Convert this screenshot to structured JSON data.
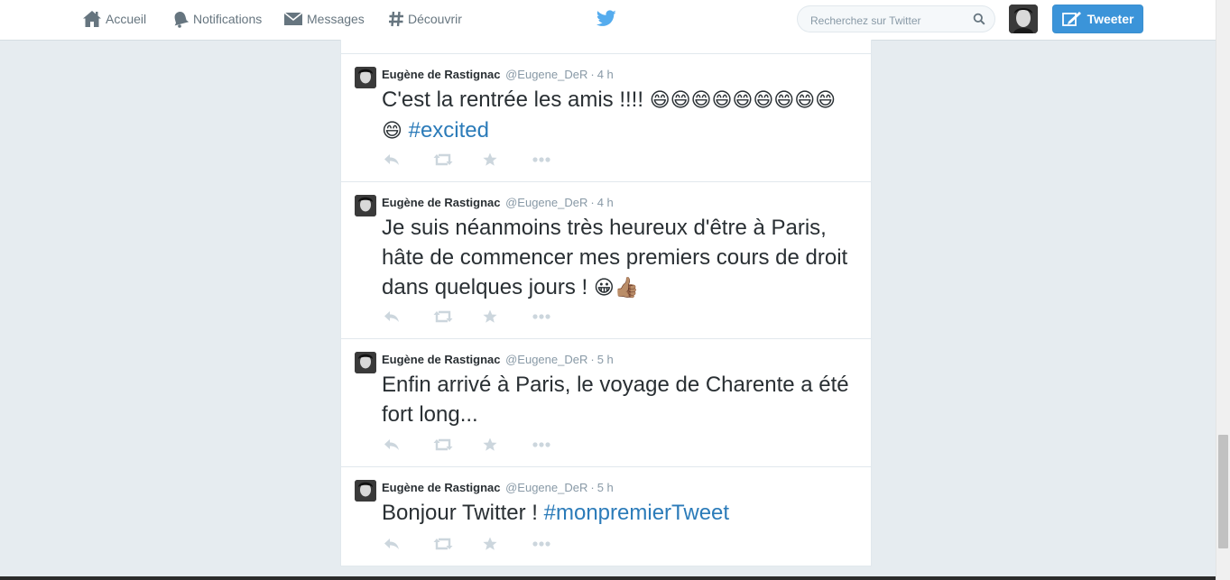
{
  "nav": {
    "home": "Accueil",
    "notifications": "Notifications",
    "messages": "Messages",
    "discover": "Découvrir",
    "logo_icon": "twitter-bird-icon",
    "search_placeholder": "Recherchez sur Twitter",
    "tweet_button": "Tweeter"
  },
  "colors": {
    "accent": "#55acee",
    "link": "#2b7bb9",
    "button": "#3b94d9",
    "background": "#e6ecf0"
  },
  "tweets": [
    {
      "fullname": "Eugène de Rastignac",
      "username": "@Eugene_DeR",
      "time": "4 h",
      "text_before": "C'est la rentrée les amis !!!! ",
      "emoji": "😄😄😄😄😄😄😄😄😄😄",
      "hashtag": "#excited",
      "text_after": ""
    },
    {
      "fullname": "Eugène de Rastignac",
      "username": "@Eugene_DeR",
      "time": "4 h",
      "text_before": "Je suis néanmoins très heureux d'être à Paris, hâte de commencer mes premiers cours de droit dans quelques jours ! ",
      "emoji": "😀👍🏽",
      "hashtag": "",
      "text_after": ""
    },
    {
      "fullname": "Eugène de Rastignac",
      "username": "@Eugene_DeR",
      "time": "5 h",
      "text_before": "Enfin arrivé à Paris, le voyage de Charente a été fort long...",
      "emoji": "",
      "hashtag": "",
      "text_after": ""
    },
    {
      "fullname": "Eugène de Rastignac",
      "username": "@Eugene_DeR",
      "time": "5 h",
      "text_before": "Bonjour Twitter ! ",
      "emoji": "",
      "hashtag": "#monpremierTweet",
      "text_after": ""
    }
  ],
  "actions": [
    "reply-icon",
    "retweet-icon",
    "favorite-icon",
    "more-icon"
  ]
}
